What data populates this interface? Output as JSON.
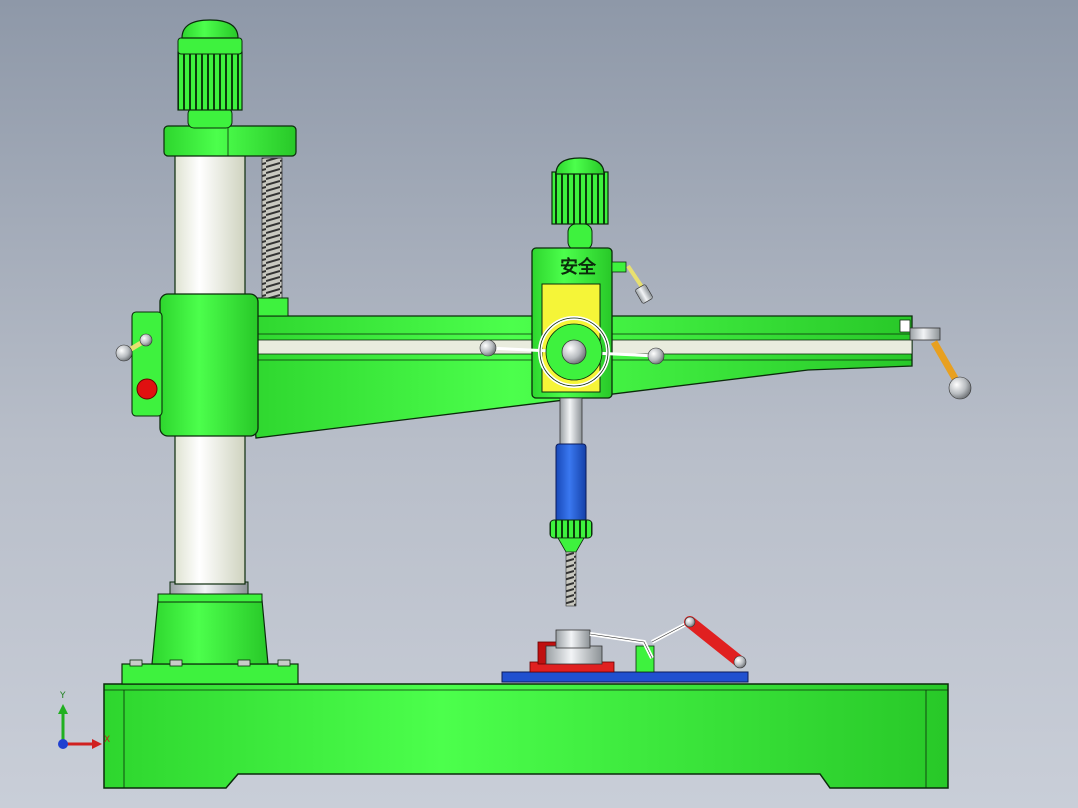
{
  "headstock": {
    "label": "安全"
  },
  "triad": {
    "x_label": "X",
    "y_label": "Y"
  },
  "colors": {
    "machine_green": "#3ef23e",
    "outline": "#0b2b0b",
    "column_white": "#f4f6ea",
    "guard_yellow": "#f5f538",
    "quill_blue": "#1f5fd8",
    "stop_red": "#e01010",
    "clamp_red": "#e02020",
    "fixture_blue": "#2050d0",
    "lever_orange": "#e8a020"
  }
}
